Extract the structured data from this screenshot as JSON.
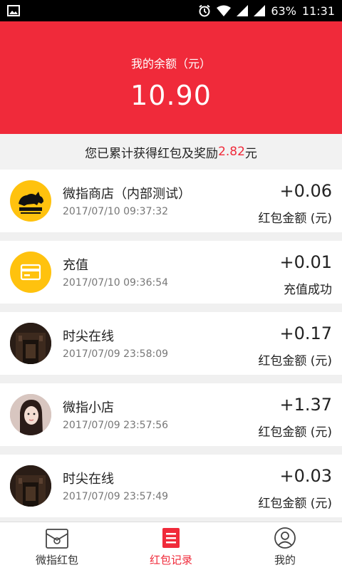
{
  "status_bar": {
    "battery": "63%",
    "time": "11:31"
  },
  "header": {
    "label": "我的余额（元）",
    "balance": "10.90"
  },
  "summary": {
    "prefix": "您已累计获得红包及奖励",
    "amount": "2.82",
    "suffix": "元"
  },
  "records": [
    {
      "title": "微指商店（内部测试）",
      "time": "2017/07/10 09:37:32",
      "amount": "+0.06",
      "subtitle": "红包金额 (元)",
      "avatar": "rino-logo"
    },
    {
      "title": "充值",
      "time": "2017/07/10 09:36:54",
      "amount": "+0.01",
      "subtitle": "充值成功",
      "avatar": "card-icon"
    },
    {
      "title": "时尖在线",
      "time": "2017/07/09 23:58:09",
      "amount": "+0.17",
      "subtitle": "红包金额 (元)",
      "avatar": "building-photo"
    },
    {
      "title": "微指小店",
      "time": "2017/07/09 23:57:56",
      "amount": "+1.37",
      "subtitle": "红包金额 (元)",
      "avatar": "person-photo"
    },
    {
      "title": "时尖在线",
      "time": "2017/07/09 23:57:49",
      "amount": "+0.03",
      "subtitle": "红包金额 (元)",
      "avatar": "building-photo"
    }
  ],
  "tabs": [
    {
      "label": "微指红包",
      "icon": "envelope-icon"
    },
    {
      "label": "红包记录",
      "icon": "record-icon"
    },
    {
      "label": "我的",
      "icon": "user-icon"
    }
  ],
  "colors": {
    "accent": "#f02a3a",
    "yellow": "#ffc20e"
  }
}
